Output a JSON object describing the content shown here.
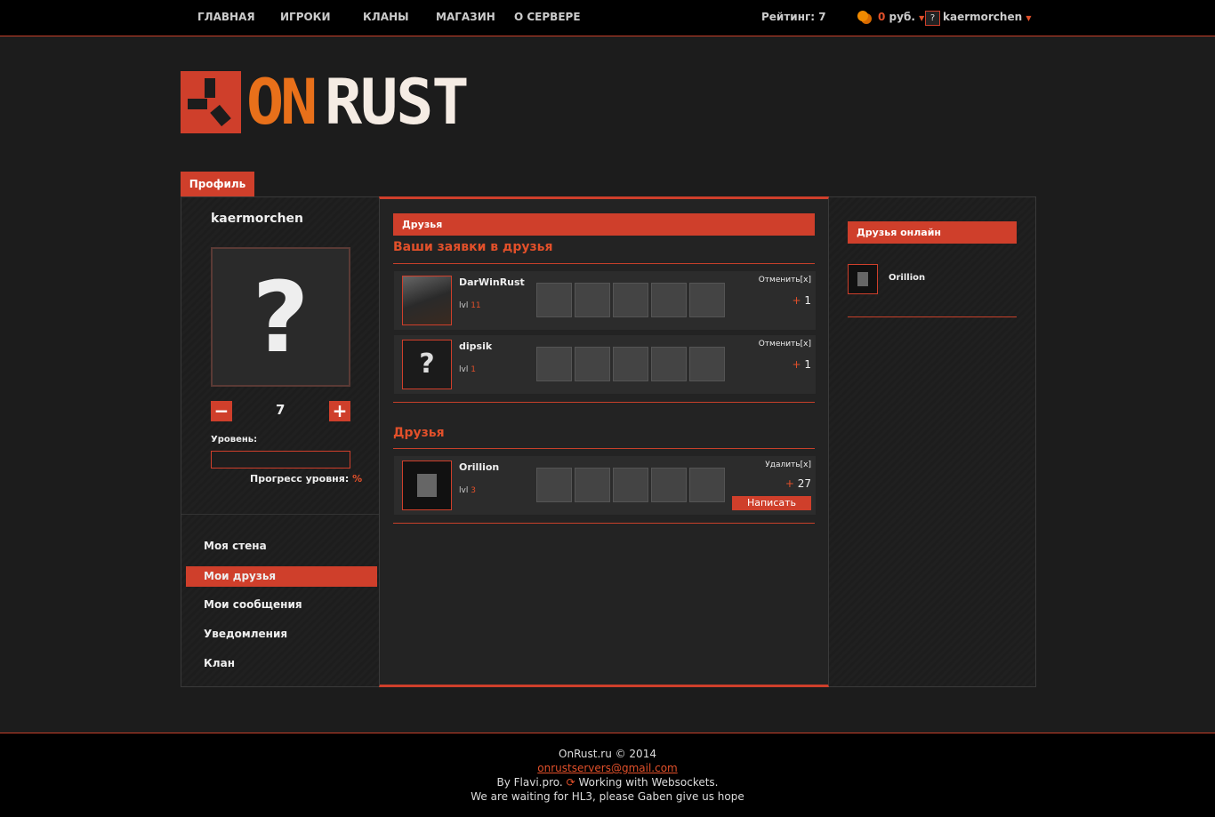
{
  "nav": {
    "items": [
      "ГЛАВНАЯ",
      "ИГРОКИ",
      "КЛАНЫ",
      "МАГАЗИН",
      "О СЕРВЕРЕ"
    ],
    "rating": "Рейтинг: 7",
    "balance_amount": "0",
    "balance_unit": " руб.",
    "username": "kaermorchen"
  },
  "logo": {
    "text_on": "ON",
    "text_rust": "RUST"
  },
  "tab": "Профиль",
  "profile": {
    "name": "kaermorchen",
    "rating": "7",
    "level_label": "Уровень:",
    "progress_label": "Прогресс уровня:",
    "progress_unit": "%",
    "progress_value": 0
  },
  "sidebar": [
    "Моя стена",
    "Мои друзья",
    "Мои сообщения",
    "Уведомления",
    "Клан"
  ],
  "main": {
    "header": "Друзья",
    "requests_title": "Ваши заявки в друзья",
    "friends_title": "Друзья",
    "requests": [
      {
        "name": "DarWinRust",
        "lvl": "lvl",
        "level": "11",
        "action": "Отменить[x]",
        "plus": "+",
        "points": "1"
      },
      {
        "name": "dipsik",
        "lvl": "lvl",
        "level": "1",
        "action": "Отменить[x]",
        "plus": "+",
        "points": "1"
      }
    ],
    "friends": [
      {
        "name": "Orillion",
        "lvl": "lvl",
        "level": "3",
        "action": "Удалить[x]",
        "plus": "+",
        "points": "27",
        "write": "Написать"
      }
    ]
  },
  "online": {
    "header": "Друзья онлайн",
    "friends": [
      "Orillion"
    ]
  },
  "footer": {
    "copy": "OnRust.ru © 2014",
    "email": "onrustservers@gmail.com",
    "by": "By Flavi.pro.",
    "ws": " Working with Websockets.",
    "hl3": "We are waiting for HL3, please Gaben give us hope"
  },
  "colors": {
    "accent": "#cf3f2b",
    "orange": "#e2502a",
    "bg": "#1c1c1c"
  }
}
